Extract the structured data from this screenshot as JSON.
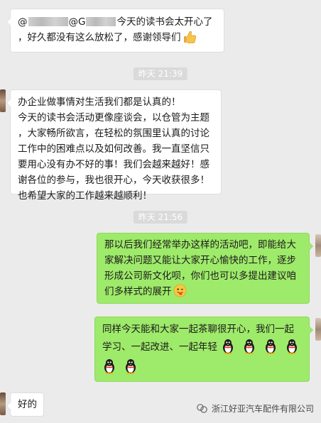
{
  "messages": [
    {
      "side": "left",
      "sender_prefix": "@",
      "sender_mid": "@G",
      "lines": [
        "今天的读书会太开心了",
        "，好久都没有这么放松了，感谢领导们"
      ],
      "emoji": "thumbs-up"
    },
    {
      "side": "left",
      "lines": [
        "办企业做事情对生活我们都是认真的！",
        "今天的读书会活动更像座谈会，以仓管为主题",
        "，大家畅所欲言，在轻松的氛围里认真的讨论",
        "工作中的困难点以及如何改善。我一直坚信只",
        "要用心没有办不好的事！我们会越来越好！感",
        "谢各位的参与，我也很开心，今天收获很多！",
        "也希望大家的工作越来越顺利！"
      ]
    },
    {
      "side": "right",
      "lines": [
        "那以后我们经常举办这样的活动吧，即能给大",
        "家解决问题又能让大家开心愉快的工作，逐步",
        "形成公司新文化呗，你们也可以多提出建议咱",
        "们多样式的展开"
      ],
      "emoji": "wink-tongue"
    },
    {
      "side": "right",
      "lines": [
        "同样今天能和大家一起茶聊很开心，我们一起",
        "学习、一起改进、一起年轻"
      ],
      "emoji": "penguin"
    },
    {
      "side": "left",
      "lines": [
        "好的"
      ]
    }
  ],
  "timestamps": [
    "昨天 21:39",
    "昨天 21:56"
  ],
  "watermark": {
    "text": "浙江好亚汽车配件有限公司",
    "icon": "wechat-official-account-icon"
  },
  "colors": {
    "background": "#ebebeb",
    "bubble_left": "#ffffff",
    "bubble_right": "#9eea6a",
    "timestamp_bg": "#dadada"
  }
}
